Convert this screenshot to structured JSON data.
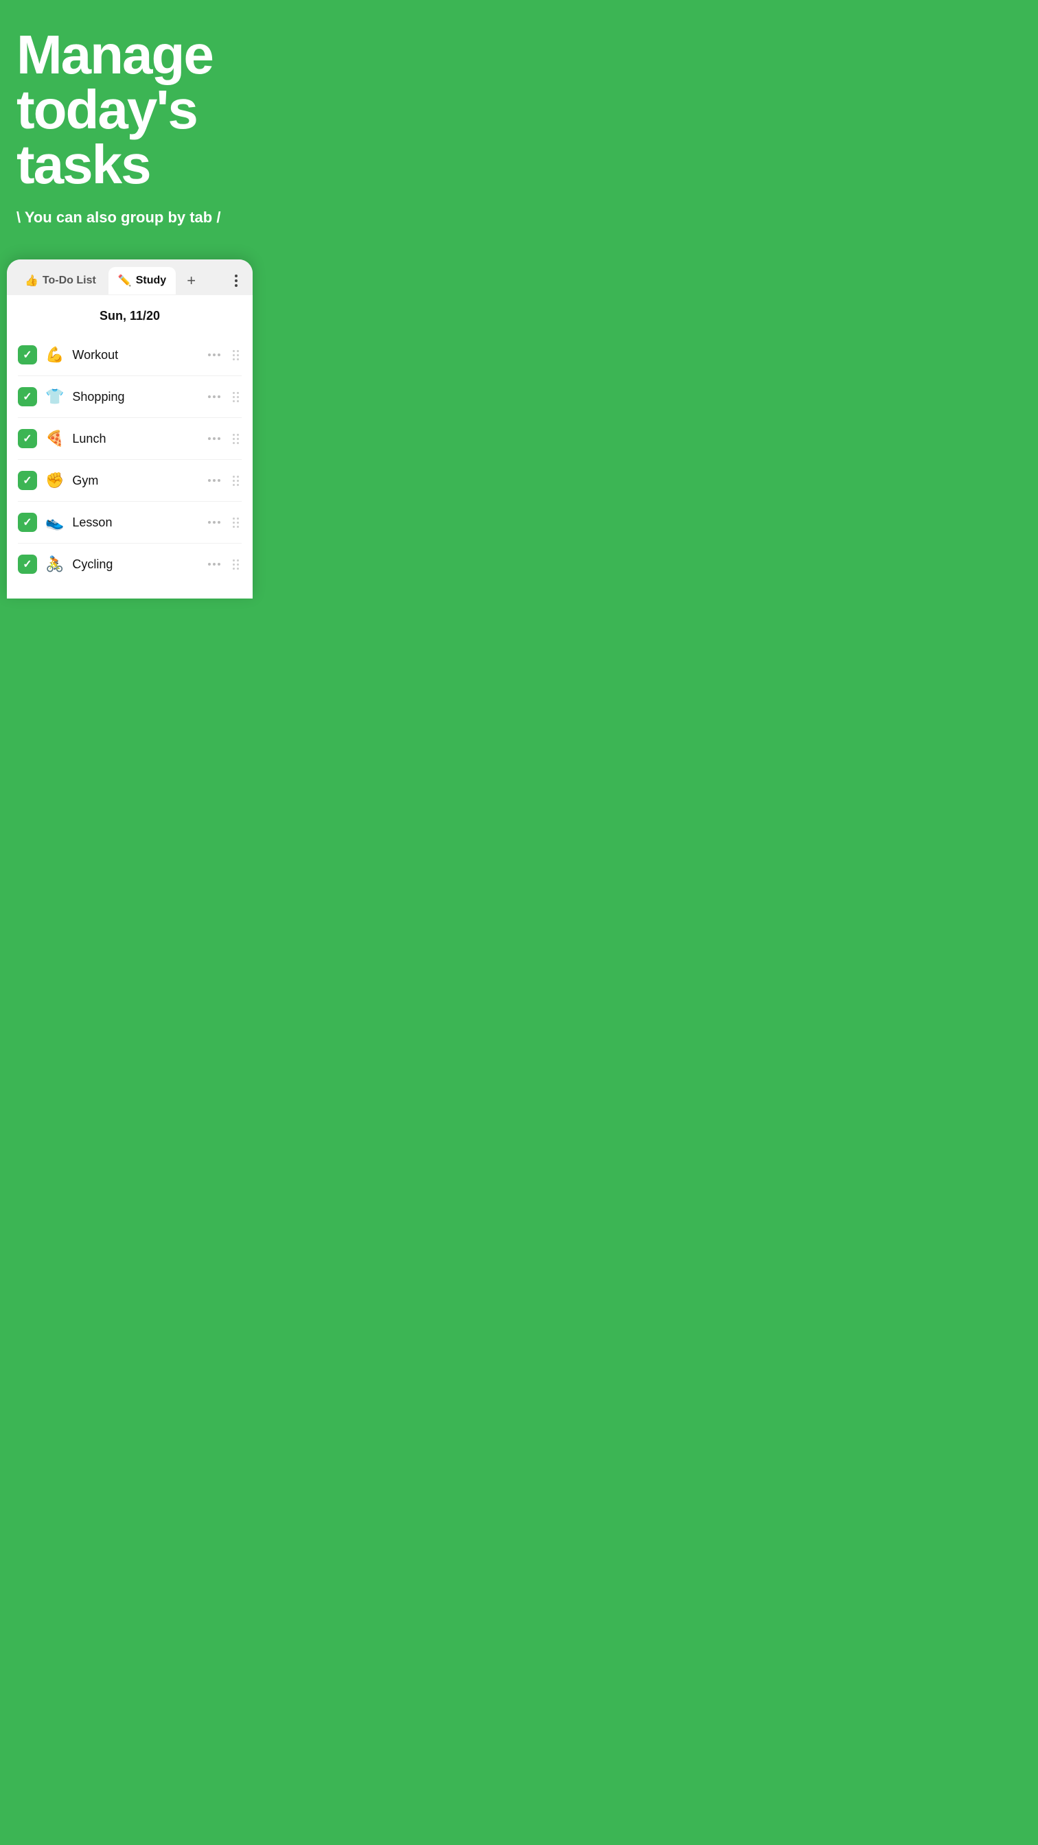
{
  "hero": {
    "title": "Manage today's tasks",
    "subtitle": "\\ You can also group by tab /",
    "background_color": "#3cb554"
  },
  "app": {
    "tabs": [
      {
        "id": "todo",
        "emoji": "👍",
        "label": "To-Do List",
        "active": false
      },
      {
        "id": "study",
        "emoji": "✏️",
        "label": "Study",
        "active": true
      }
    ],
    "add_tab_label": "+",
    "more_label": "⋮",
    "date": "Sun, 11/20",
    "tasks": [
      {
        "id": 1,
        "emoji": "💪",
        "name": "Workout",
        "checked": true
      },
      {
        "id": 2,
        "emoji": "👕",
        "name": "Shopping",
        "checked": true
      },
      {
        "id": 3,
        "emoji": "🍕",
        "name": "Lunch",
        "checked": true
      },
      {
        "id": 4,
        "emoji": "✊",
        "name": "Gym",
        "checked": true
      },
      {
        "id": 5,
        "emoji": "👟",
        "name": "Lesson",
        "checked": true
      },
      {
        "id": 6,
        "emoji": "🚴",
        "name": "Cycling",
        "checked": true
      }
    ]
  }
}
